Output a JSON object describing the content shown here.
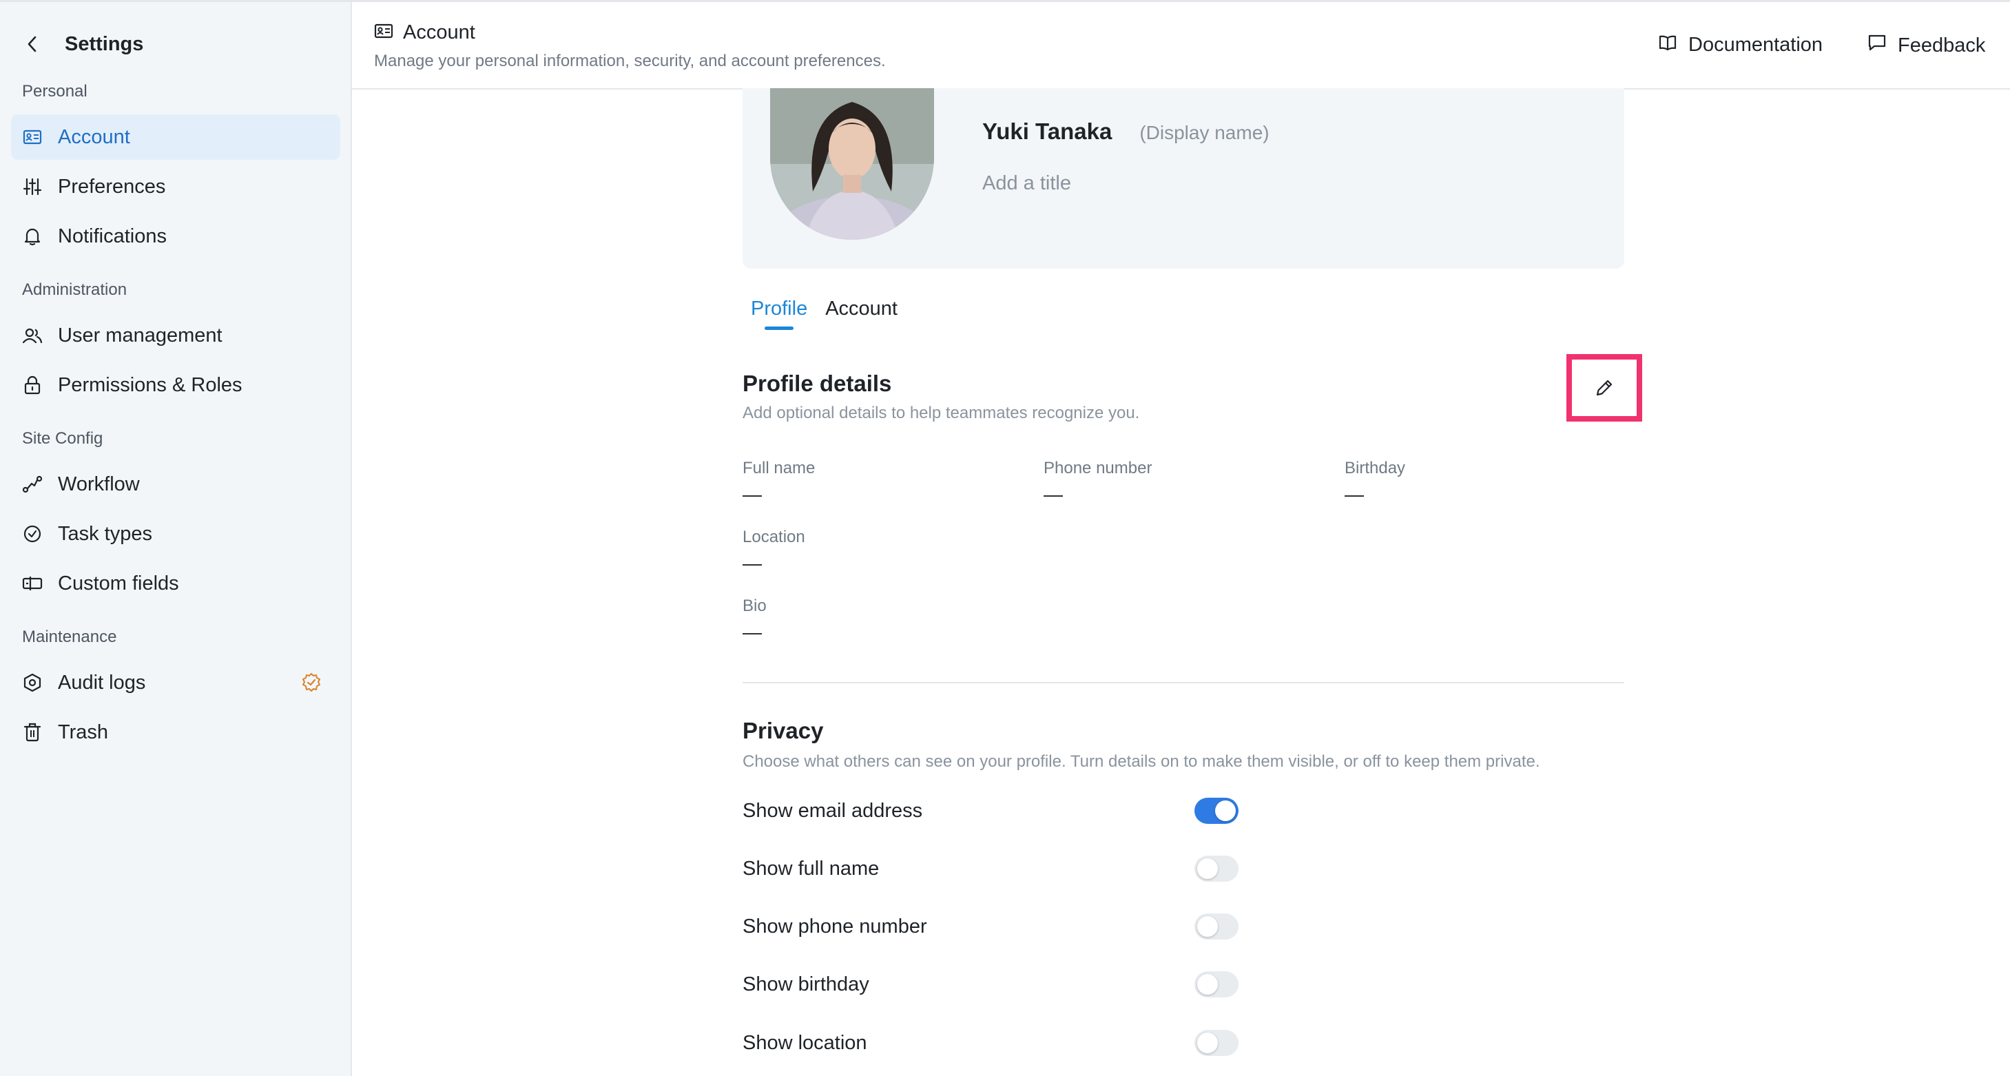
{
  "sidebar": {
    "title": "Settings",
    "sections": {
      "personal": "Personal",
      "administration": "Administration",
      "site_config": "Site Config",
      "maintenance": "Maintenance"
    },
    "items": {
      "account": "Account",
      "preferences": "Preferences",
      "notifications": "Notifications",
      "user_management": "User management",
      "permissions_roles": "Permissions & Roles",
      "workflow": "Workflow",
      "task_types": "Task types",
      "custom_fields": "Custom fields",
      "audit_logs": "Audit logs",
      "trash": "Trash"
    },
    "active_item": "account",
    "badge_color": "#d9822b"
  },
  "header": {
    "title": "Account",
    "subtitle": "Manage your personal information, security, and account preferences.",
    "documentation": "Documentation",
    "feedback": "Feedback"
  },
  "profile": {
    "name": "Yuki Tanaka",
    "display_name_hint": "(Display name)",
    "title_placeholder": "Add a title"
  },
  "tabs": {
    "profile": "Profile",
    "account": "Account",
    "active": "profile"
  },
  "profile_details": {
    "title": "Profile details",
    "subtitle": "Add optional details to help teammates recognize you.",
    "fields": {
      "full_name": {
        "label": "Full name",
        "value": "—"
      },
      "phone_number": {
        "label": "Phone number",
        "value": "—"
      },
      "birthday": {
        "label": "Birthday",
        "value": "—"
      },
      "location": {
        "label": "Location",
        "value": "—"
      },
      "bio": {
        "label": "Bio",
        "value": "—"
      }
    }
  },
  "privacy": {
    "title": "Privacy",
    "subtitle": "Choose what others can see on your profile. Turn details on to make them visible, or off to keep them private.",
    "toggles": [
      {
        "label": "Show email address",
        "on": true
      },
      {
        "label": "Show full name",
        "on": false
      },
      {
        "label": "Show phone number",
        "on": false
      },
      {
        "label": "Show birthday",
        "on": false
      },
      {
        "label": "Show location",
        "on": false
      }
    ]
  },
  "colors": {
    "accent": "#1c86d8",
    "toggle_on": "#2f7be4",
    "highlight": "#f0326e"
  }
}
